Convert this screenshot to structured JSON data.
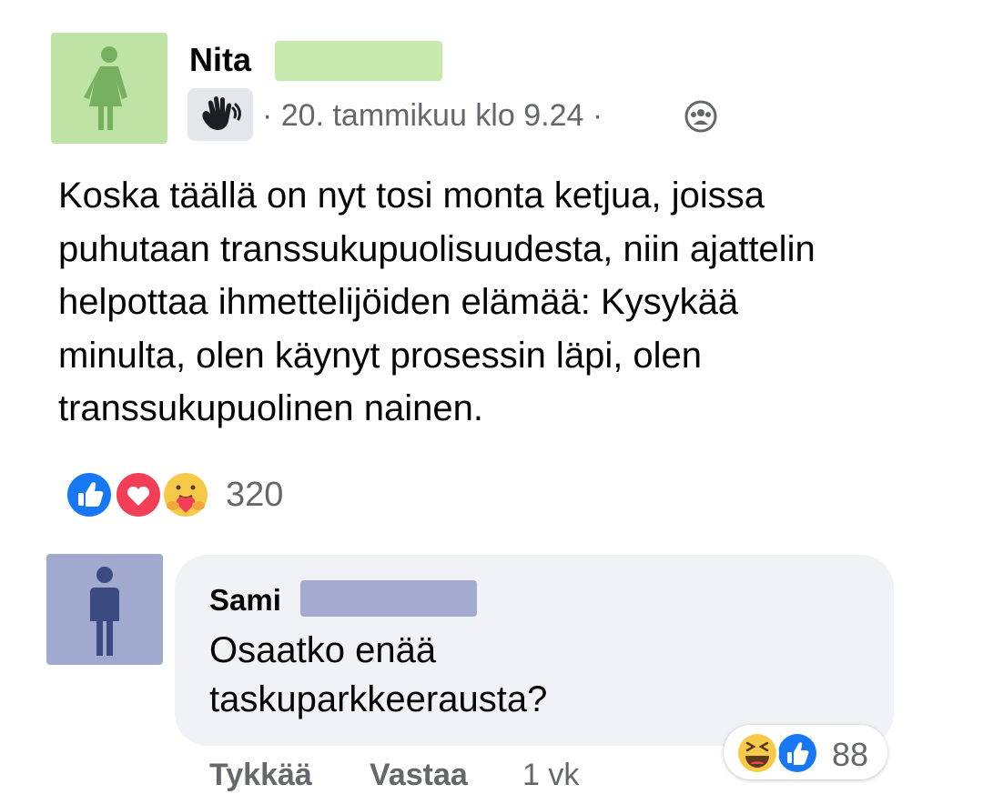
{
  "post": {
    "author": "Nita",
    "meta": "· 20. tammikuu klo 9.24 ·",
    "badge_icon": "waving-hand-icon",
    "audience_icon": "group-icon",
    "text_lines": [
      "Koska täällä on nyt tosi monta ketjua, joissa",
      "puhutaan transsukupuolisuudesta, niin ajattelin",
      "helpottaa ihmettelijöiden elämää: Kysykää",
      "minulta, olen käynyt prosessin läpi, olen",
      "transsukupuolinen nainen."
    ],
    "reactions": [
      "like-icon",
      "love-icon",
      "care-icon"
    ],
    "reaction_count": "320"
  },
  "comment": {
    "author": "Sami",
    "text_lines": [
      "Osaatko enää",
      "taskuparkkeerausta?"
    ],
    "reactions": [
      "haha-icon",
      "like-icon"
    ],
    "reaction_count": "88",
    "actions": {
      "like": "Tykkää",
      "reply": "Vastaa",
      "time": "1 vk"
    }
  },
  "colors": {
    "post_avatar_bg": "#bfe3a4",
    "post_avatar_figure": "#76b060",
    "comment_avatar_bg": "#a2a9cf",
    "comment_avatar_figure": "#3b4a80",
    "bubble_bg": "#f0f2f5",
    "secondary_text": "#65676b",
    "like_blue": "#1877f2",
    "love_red": "#f33e58"
  }
}
